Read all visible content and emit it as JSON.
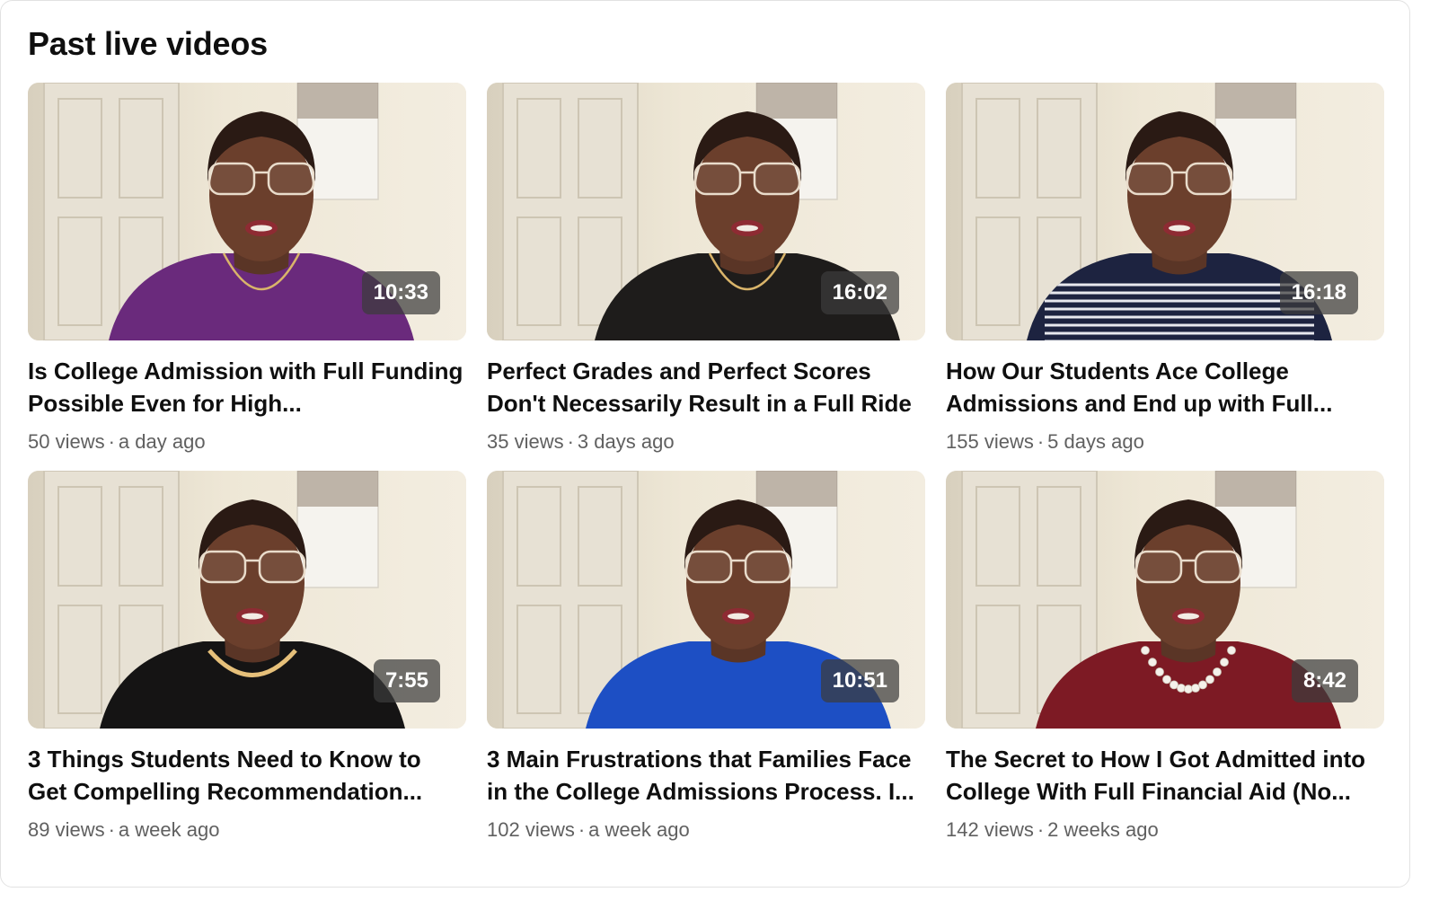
{
  "section": {
    "title": "Past live videos"
  },
  "videos": [
    {
      "title": "Is College Admission with Full Funding Possible Even for High...",
      "duration": "10:33",
      "views": "50 views",
      "age": "a day ago",
      "shirt_color": "#6a2a7c",
      "neck_accessory": "gold-chain-icon"
    },
    {
      "title": "Perfect Grades and Perfect Scores Don't Necessarily Result in a Full Ride",
      "duration": "16:02",
      "views": "35 views",
      "age": "3 days ago",
      "shirt_color": "#1e1c1b",
      "neck_accessory": "gold-chain-icon"
    },
    {
      "title": "How Our Students Ace College Admissions and End up with Full...",
      "duration": "16:18",
      "views": "155 views",
      "age": "5 days ago",
      "shirt_color": "#1d2340",
      "neck_accessory": "striped-shirt-icon"
    },
    {
      "title": "3 Things Students Need to Know to Get Compelling Recommendation...",
      "duration": "7:55",
      "views": "89 views",
      "age": "a week ago",
      "shirt_color": "#151414",
      "neck_accessory": "gold-necklace-icon"
    },
    {
      "title": "3 Main Frustrations that Families Face in the College Admissions Process. I...",
      "duration": "10:51",
      "views": "102 views",
      "age": "a week ago",
      "shirt_color": "#1d4fc4",
      "neck_accessory": "none"
    },
    {
      "title": "The Secret to How I Got Admitted into College With Full Financial Aid (No...",
      "duration": "8:42",
      "views": "142 views",
      "age": "2 weeks ago",
      "shirt_color": "#7d1a24",
      "neck_accessory": "pearl-necklace-icon"
    }
  ],
  "separator": "·"
}
